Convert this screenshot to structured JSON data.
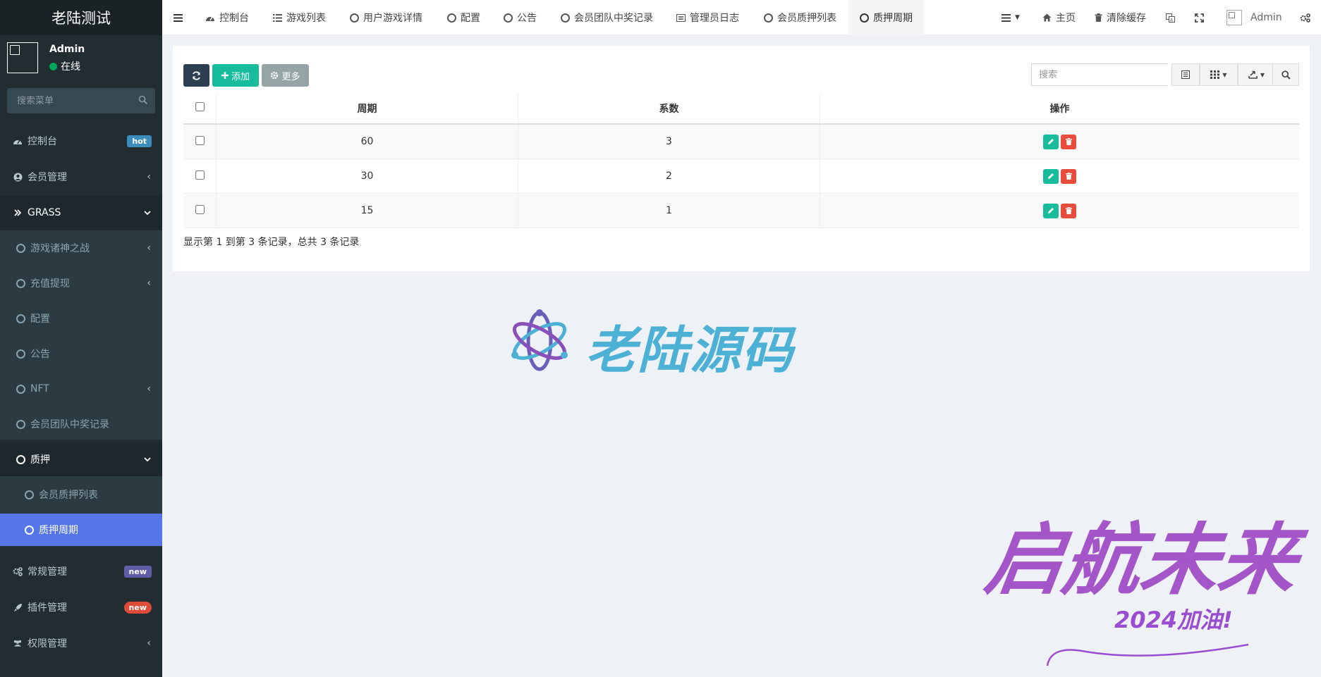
{
  "sidebar": {
    "brand": "老陆测试",
    "user": {
      "name": "Admin",
      "status": "在线"
    },
    "search_placeholder": "搜索菜单",
    "items": [
      {
        "label": "控制台",
        "badge": "hot"
      },
      {
        "label": "会员管理"
      },
      {
        "label": "GRASS"
      },
      {
        "label": "游戏诸神之战"
      },
      {
        "label": "充值提现"
      },
      {
        "label": "配置"
      },
      {
        "label": "公告"
      },
      {
        "label": "NFT"
      },
      {
        "label": "会员团队中奖记录"
      },
      {
        "label": "质押"
      },
      {
        "label": "会员质押列表"
      },
      {
        "label": "质押周期"
      },
      {
        "label": "常规管理",
        "badge": "new"
      },
      {
        "label": "插件管理",
        "badge": "new"
      },
      {
        "label": "权限管理"
      }
    ]
  },
  "header": {
    "tabs": [
      {
        "label": "控制台",
        "icon": "dashboard-icon"
      },
      {
        "label": "游戏列表",
        "icon": "list-icon"
      },
      {
        "label": "用户游戏详情",
        "icon": "circle-icon"
      },
      {
        "label": "配置",
        "icon": "circle-icon"
      },
      {
        "label": "公告",
        "icon": "circle-icon"
      },
      {
        "label": "会员团队中奖记录",
        "icon": "circle-icon"
      },
      {
        "label": "管理员日志",
        "icon": "list-alt-icon"
      },
      {
        "label": "会员质押列表",
        "icon": "circle-icon"
      },
      {
        "label": "质押周期",
        "icon": "circle-icon",
        "active": true
      }
    ],
    "right": {
      "home": "主页",
      "clear_cache": "清除缓存",
      "admin": "Admin"
    }
  },
  "toolbar": {
    "add_label": "添加",
    "more_label": "更多",
    "search_placeholder": "搜索"
  },
  "table": {
    "columns": [
      "周期",
      "系数",
      "操作"
    ],
    "rows": [
      {
        "period": "60",
        "coef": "3"
      },
      {
        "period": "30",
        "coef": "2"
      },
      {
        "period": "15",
        "coef": "1"
      }
    ],
    "summary": "显示第 1 到第 3 条记录，总共 3 条记录"
  },
  "watermarks": {
    "logo_text": "老陆源码",
    "slogan": "启航未来",
    "slogan_sub": "2024加油!"
  },
  "colors": {
    "sidebar_bg": "#222d32",
    "active_item": "#5575e8",
    "add_button": "#18bc9c",
    "refresh_button": "#2c3e50",
    "more_button": "#95a5a6",
    "delete_button": "#e74c3c"
  }
}
